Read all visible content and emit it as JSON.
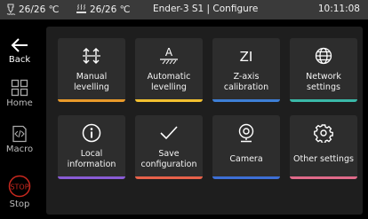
{
  "status_bar": {
    "nozzle_temp": "26/26 ℃",
    "bed_temp": "26/26 ℃",
    "title": "Ender-3 S1 | Configure",
    "time": "10:11:08",
    "nozzle_icon": "nozzle-icon",
    "bed_icon": "heated-bed-icon"
  },
  "sidebar": {
    "back": "Back",
    "home": "Home",
    "macro": "Macro",
    "stop": "Stop",
    "stop_icon_text": "STOP"
  },
  "tiles": [
    {
      "line1": "Manual",
      "line2": "levelling",
      "icon": "manual-levelling-icon",
      "accent": "#e89a2a"
    },
    {
      "line1": "Automatic",
      "line2": "levelling",
      "icon": "auto-levelling-icon",
      "accent": "#f2c030"
    },
    {
      "line1": "Z-axis",
      "line2": "calibration",
      "icon": "z-axis-icon",
      "accent": "#3d7fd6"
    },
    {
      "line1": "Network",
      "line2": "settings",
      "icon": "globe-icon",
      "accent": "#3ab8a8"
    },
    {
      "line1": "Local",
      "line2": "information",
      "icon": "info-icon",
      "accent": "#8a5cd6"
    },
    {
      "line1": "Save",
      "line2": "configuration",
      "icon": "checkmark-icon",
      "accent": "#e8624a"
    },
    {
      "line1": "Camera",
      "icon": "camera-icon",
      "accent": "#3d6fd6"
    },
    {
      "line1": "Other settings",
      "icon": "gear-icon",
      "accent": "#e06a8a"
    }
  ],
  "icon_glyphs": {
    "auto_levelling": "A",
    "z_axis": "ZI"
  },
  "colors": {
    "status_bar_bg": "#3a3a3a",
    "panel_bg": "#1e1e1e",
    "tile_bg": "#2d2d2d",
    "stop_red": "#c8281e"
  }
}
